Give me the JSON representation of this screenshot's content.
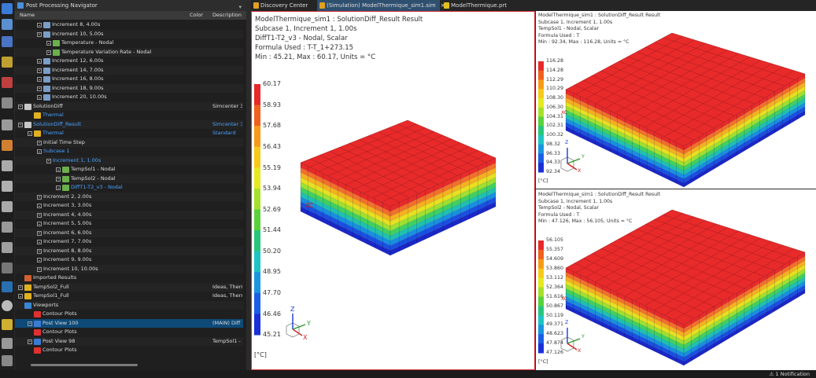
{
  "navigator": {
    "title": "Post Processing Navigator",
    "columns": {
      "name": "Name",
      "color": "Color",
      "description": "Description"
    },
    "rows": [
      {
        "label": "Increment 8, 4.00s",
        "indent": 2,
        "icon": "increment",
        "exp": true
      },
      {
        "label": "Increment 10, 5.00s",
        "indent": 2,
        "icon": "increment",
        "exp": true
      },
      {
        "label": "Temperature - Nodal",
        "indent": 3,
        "icon": "result",
        "exp": true
      },
      {
        "label": "Temperature Variation Rate - Nodal",
        "indent": 3,
        "icon": "result",
        "exp": true
      },
      {
        "label": "Increment 12, 6.00s",
        "indent": 2,
        "icon": "increment",
        "exp": true
      },
      {
        "label": "Increment 14, 7.00s",
        "indent": 2,
        "icon": "increment",
        "exp": true
      },
      {
        "label": "Increment 16, 8.00s",
        "indent": 2,
        "icon": "increment",
        "exp": true
      },
      {
        "label": "Increment 18, 9.00s",
        "indent": 2,
        "icon": "increment",
        "exp": true
      },
      {
        "label": "Increment 20, 10.00s",
        "indent": 2,
        "icon": "increment",
        "exp": true
      },
      {
        "label": "SolutionDiff",
        "indent": 0,
        "icon": "folder",
        "exp": true,
        "desc": "Simcenter 3"
      },
      {
        "label": "Thermal",
        "indent": 1,
        "icon": "thermal",
        "link": true
      },
      {
        "label": "SolutionDiff_Result",
        "indent": 0,
        "icon": "folder",
        "exp": true,
        "link": true,
        "desc": "Simcenter 3",
        "descLink": true
      },
      {
        "label": "Thermal",
        "indent": 1,
        "icon": "thermal",
        "link": true,
        "exp": true,
        "desc": "Standard",
        "descLink": true
      },
      {
        "label": "Initial Time Step",
        "indent": 2,
        "icon": "none",
        "exp": true
      },
      {
        "label": "Subcase 1",
        "indent": 2,
        "icon": "none",
        "exp": true,
        "link": true
      },
      {
        "label": "Increment 1, 1.00s",
        "indent": 3,
        "icon": "none",
        "exp": true,
        "link": true
      },
      {
        "label": "TempSol1 - Nodal",
        "indent": 4,
        "icon": "result",
        "exp": true
      },
      {
        "label": "TempSol2 - Nodal",
        "indent": 4,
        "icon": "result",
        "exp": true
      },
      {
        "label": "DiffT1-T2_v3 - Nodal",
        "indent": 4,
        "icon": "result",
        "exp": true,
        "link": true
      },
      {
        "label": "Increment 2, 2.00s",
        "indent": 2,
        "icon": "none",
        "exp": true
      },
      {
        "label": "Increment 3, 3.00s",
        "indent": 2,
        "icon": "none",
        "exp": true
      },
      {
        "label": "Increment 4, 4.00s",
        "indent": 2,
        "icon": "none",
        "exp": true
      },
      {
        "label": "Increment 5, 5.00s",
        "indent": 2,
        "icon": "none",
        "exp": true
      },
      {
        "label": "Increment 6, 6.00s",
        "indent": 2,
        "icon": "none",
        "exp": true
      },
      {
        "label": "Increment 7, 7.00s",
        "indent": 2,
        "icon": "none",
        "exp": true
      },
      {
        "label": "Increment 8, 8.00s",
        "indent": 2,
        "icon": "none",
        "exp": true
      },
      {
        "label": "Increment 9, 9.00s",
        "indent": 2,
        "icon": "none",
        "exp": true
      },
      {
        "label": "Increment 10, 10.00s",
        "indent": 2,
        "icon": "none",
        "exp": true
      },
      {
        "label": "Imported Results",
        "indent": 0,
        "icon": "import",
        "exp": false
      },
      {
        "label": "TempSol2_Full",
        "indent": 0,
        "icon": "thermal",
        "exp": true,
        "desc": "Ideas, Therm"
      },
      {
        "label": "TempSol1_Full",
        "indent": 0,
        "icon": "thermal",
        "exp": true,
        "desc": "Ideas, Therm"
      },
      {
        "label": "Viewports",
        "indent": 0,
        "icon": "viewport",
        "exp": false
      },
      {
        "label": "Contour Plots",
        "indent": 1,
        "icon": "plot",
        "exp": false
      },
      {
        "label": "Post View 100",
        "indent": 1,
        "icon": "postview",
        "exp": true,
        "sel": true,
        "desc": "(MAIN) Diff"
      },
      {
        "label": "Contour Plots",
        "indent": 1,
        "icon": "plot",
        "exp": false
      },
      {
        "label": "Post View 98",
        "indent": 1,
        "icon": "postview",
        "exp": true,
        "desc": "TempSol1 - "
      },
      {
        "label": "Contour Plots",
        "indent": 1,
        "icon": "plot",
        "exp": false
      }
    ]
  },
  "tabs": [
    {
      "label": "Discovery Center",
      "icon": "#e0a020",
      "active": false
    },
    {
      "label": "(Simulation) ModelThermique_sim1.sim",
      "icon": "#e0a020",
      "active": true,
      "close": "×"
    },
    {
      "label": "ModelThermique.prt",
      "icon": "#e0c020",
      "active": false
    }
  ],
  "main_view": {
    "header": [
      "ModelThermique_sim1 : SolutionDiff_Result Result",
      "Subcase 1, Increment 1, 1.00s",
      "DiffT1-T2_v3 - Nodal, Scalar",
      "Formula Used : T-T_1+273.15",
      "Min : 45.21, Max : 60.17, Units = °C"
    ],
    "legend": [
      "60.17",
      "58.93",
      "57.68",
      "56.43",
      "55.19",
      "53.94",
      "52.69",
      "51.44",
      "50.20",
      "48.95",
      "47.70",
      "46.46",
      "45.21"
    ],
    "unit": "[°C]",
    "csys_label": "XC",
    "axes": {
      "z": "Z",
      "y": "Y",
      "x": "X"
    }
  },
  "top_right_view": {
    "header": [
      "ModelThermique_sim1 : SolutionDiff_Result Result",
      "Subcase 1, Increment 1, 1.00s",
      "TempSol1 - Nodal, Scalar",
      "Formula Used : T",
      "Min : 92.34, Max : 116.28, Units = °C"
    ],
    "legend": [
      "116.28",
      "114.28",
      "112.29",
      "110.29",
      "108.30",
      "106.30",
      "104.31",
      "102.31",
      "100.32",
      "98.32",
      "96.33",
      "94.33",
      "92.34"
    ],
    "unit": "[°C]",
    "csys_label": "XC",
    "axes": {
      "z": "Z",
      "y": "Y",
      "x": "X"
    }
  },
  "bottom_right_view": {
    "header": [
      "ModelThermique_sim1 : SolutionDiff_Result Result",
      "Subcase 1, Increment 1, 1.00s",
      "TempSol2 - Nodal, Scalar",
      "Formula Used : T",
      "Min : 47.126, Max : 56.105, Units = °C"
    ],
    "legend": [
      "56.105",
      "55.357",
      "54.609",
      "53.860",
      "53.112",
      "52.364",
      "51.616",
      "50.867",
      "50.119",
      "49.371",
      "48.623",
      "47.874",
      "47.126"
    ],
    "unit": "[°C]",
    "csys_label": "XC",
    "axes": {
      "z": "Z",
      "y": "Y",
      "x": "X"
    }
  },
  "status": {
    "notification": "⚠ 1 Notification"
  },
  "colors": {
    "accent": "#0e4a78",
    "link": "#4aa3ff",
    "active_border": "#d0323c"
  }
}
